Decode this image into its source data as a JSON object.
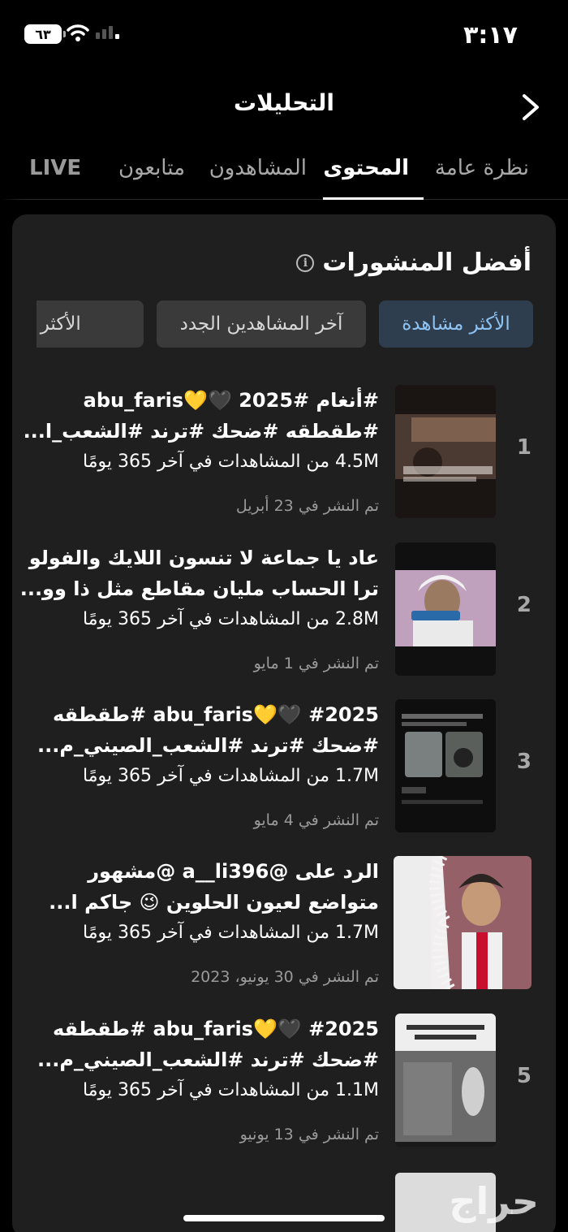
{
  "status_bar": {
    "time": "٣:١٧",
    "battery": "٦٣"
  },
  "header": {
    "title": "التحليلات"
  },
  "tabs": [
    {
      "label": "نظرة عامة",
      "active": false
    },
    {
      "label": "المحتوى",
      "active": true
    },
    {
      "label": "المشاهدون",
      "active": false
    },
    {
      "label": "متابعون",
      "active": false
    },
    {
      "label": "LIVE",
      "active": false
    }
  ],
  "section": {
    "title": "أفضل المنشورات"
  },
  "filters": [
    {
      "label": "الأكثر مشاهدة",
      "active": true
    },
    {
      "label": "آخر المشاهدين الجدد",
      "active": false
    },
    {
      "label": "الأكثر إعجابًا",
      "active": false
    }
  ],
  "posts": [
    {
      "rank": "1",
      "line1": "#أنغام #2025 🖤💛abu_faris",
      "line2": "#طقطقه #ضحك #ترند #الشعب_ا...",
      "views": "4.5M من المشاهدات في آخر 365 يومًا",
      "posted": "تم النشر في 23 أبريل"
    },
    {
      "rank": "2",
      "line1": "عاد يا جماعة لا تنسون اللايك والفولو",
      "line2": "ترا الحساب مليان مقاطع مثل ذا وو...",
      "views": "2.8M من المشاهدات في آخر 365 يومًا",
      "posted": "تم النشر في 1 مايو"
    },
    {
      "rank": "3",
      "line1": "#2025 🖤💛abu_faris #طقطقه",
      "line2": "#ضحك #ترند #الشعب_الصيني_م...",
      "views": "1.7M من المشاهدات في آخر 365 يومًا",
      "posted": "تم النشر في 4 مايو"
    },
    {
      "rank": "",
      "line1": "الرد على @a__li396 @مشهور",
      "line2": "متواضع لعيون الحلوين 😉 جاكم ا...",
      "views": "1.7M من المشاهدات في آخر 365 يومًا",
      "posted": "تم النشر في 30 يونيو، 2023"
    },
    {
      "rank": "5",
      "line1": "#2025 🖤💛abu_faris #طقطقه",
      "line2": "#ضحك #ترند #الشعب_الصيني_م...",
      "views": "1.1M من المشاهدات في آخر 365 يومًا",
      "posted": "تم النشر في 13 يونيو"
    }
  ],
  "watermark": "حراج"
}
